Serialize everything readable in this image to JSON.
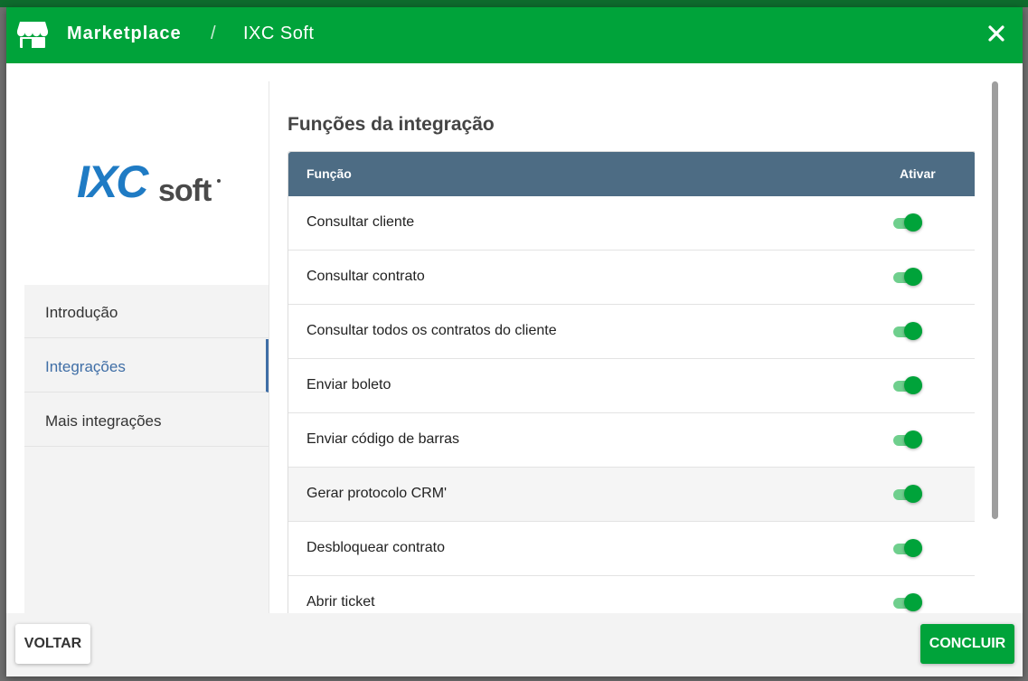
{
  "header": {
    "title": "Marketplace",
    "separator": "/",
    "subtitle": "IXC Soft",
    "store_icon": "store-icon",
    "close_icon": "close-icon"
  },
  "sidebar": {
    "logo": {
      "name": "ixcsoft-logo",
      "text_main": "IXC",
      "text_sub": "soft"
    },
    "items": [
      {
        "label": "Introdução",
        "active": false
      },
      {
        "label": "Integrações",
        "active": true
      },
      {
        "label": "Mais integrações",
        "active": false
      }
    ]
  },
  "main": {
    "section_title": "Funções da integração",
    "table": {
      "headers": {
        "function": "Função",
        "activate": "Ativar"
      },
      "rows": [
        {
          "label": "Consultar cliente",
          "enabled": true
        },
        {
          "label": "Consultar contrato",
          "enabled": true
        },
        {
          "label": "Consultar todos os contratos do cliente",
          "enabled": true
        },
        {
          "label": "Enviar boleto",
          "enabled": true
        },
        {
          "label": "Enviar código de barras",
          "enabled": true
        },
        {
          "label": "Gerar protocolo CRM'",
          "enabled": true
        },
        {
          "label": "Desbloquear contrato",
          "enabled": true
        },
        {
          "label": "Abrir ticket",
          "enabled": true
        }
      ]
    }
  },
  "footer": {
    "back_label": "VOLTAR",
    "finish_label": "CONCLUIR"
  },
  "colors": {
    "header_green": "#00a33a",
    "table_header": "#4d6c84",
    "active_nav": "#3f6ea6",
    "toggle_on": "#00a33a"
  }
}
